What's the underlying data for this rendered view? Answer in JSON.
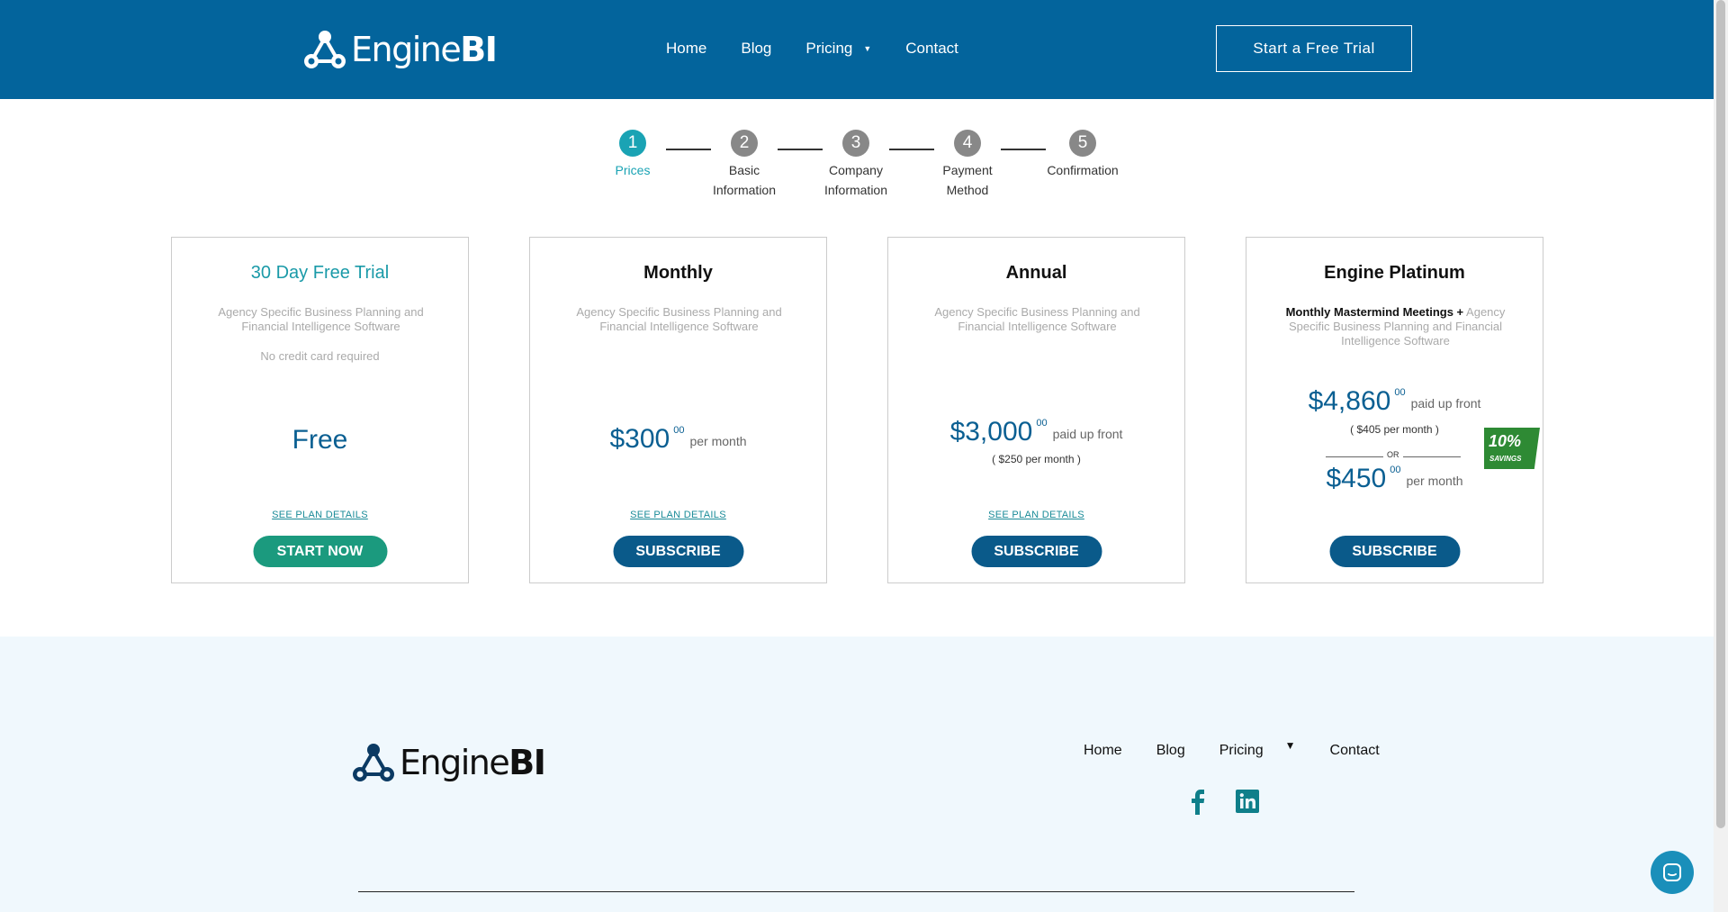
{
  "header": {
    "logo_text": "Engine",
    "logo_bold": "BI",
    "nav": [
      "Home",
      "Blog",
      "Pricing",
      "Contact"
    ],
    "trial_button": "Start a Free Trial"
  },
  "stepper": {
    "steps": [
      {
        "num": "1",
        "label": "Prices",
        "label2": ""
      },
      {
        "num": "2",
        "label": "Basic",
        "label2": "Information"
      },
      {
        "num": "3",
        "label": "Company",
        "label2": "Information"
      },
      {
        "num": "4",
        "label": "Payment",
        "label2": "Method"
      },
      {
        "num": "5",
        "label": "Confirmation",
        "label2": ""
      }
    ],
    "active": 1
  },
  "plans": [
    {
      "title": "30 Day Free Trial",
      "description": "Agency Specific Business Planning and Financial Intelligence Software",
      "note": "No credit card required",
      "price": "Free",
      "details_link": "SEE PLAN DETAILS",
      "cta": "START NOW"
    },
    {
      "title": "Monthly",
      "description": "Agency Specific Business Planning and Financial Intelligence Software",
      "price": "$300",
      "cents": "00",
      "per": "per month",
      "details_link": "SEE PLAN DETAILS",
      "cta": "SUBSCRIBE"
    },
    {
      "title": "Annual",
      "description": "Agency Specific Business Planning and Financial Intelligence Software",
      "price": "$3,000",
      "cents": "00",
      "per": "paid up front",
      "sub": "( $250 per month )",
      "details_link": "SEE PLAN DETAILS",
      "cta": "SUBSCRIBE"
    },
    {
      "title": "Engine Platinum",
      "description_bold": "Monthly Mastermind Meetings +",
      "description": "Agency Specific Business Planning and Financial Intelligence Software",
      "price": "$4,860",
      "cents": "00",
      "per": "paid up front",
      "sub": "( $405 per month )",
      "or": "OR",
      "price2": "$450",
      "cents2": "00",
      "per2": "per month",
      "badge_pct": "10%",
      "badge_label": "SAVINGS",
      "cta": "SUBSCRIBE"
    }
  ],
  "footer": {
    "logo_text": "Engine",
    "logo_bold": "BI",
    "nav": [
      "Home",
      "Blog",
      "Pricing",
      "Contact"
    ],
    "social": [
      "facebook-icon",
      "linkedin-icon"
    ]
  },
  "colors": {
    "header_bg": "#03649c",
    "accent_teal": "#1aa3b4",
    "price_blue": "#0a5f92",
    "cta_green": "#1b9a7e",
    "savings_green": "#2e8a34",
    "footer_bg": "#f0f8fd"
  }
}
